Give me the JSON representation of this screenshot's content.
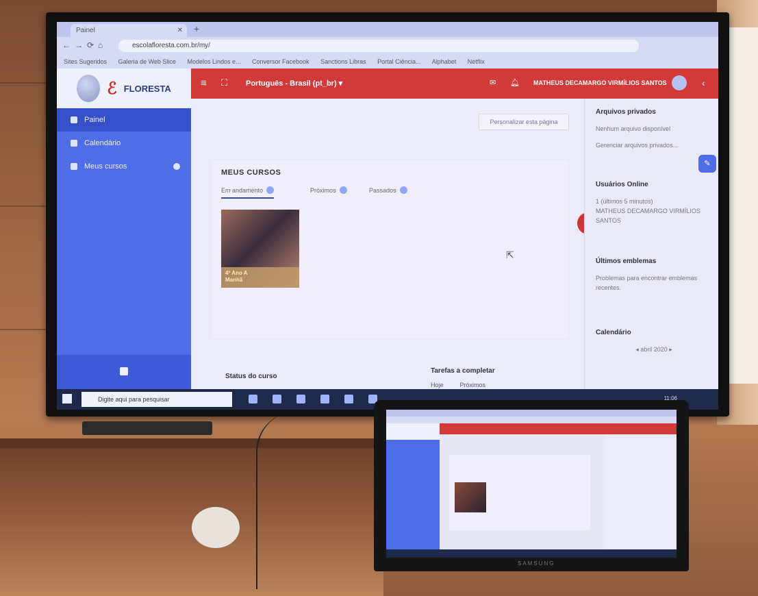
{
  "browser": {
    "tab_title": "Painel",
    "url": "escolafloresta.com.br/my/",
    "bookmarks": [
      "Sites Sugeridos",
      "Galeria de Web Slice",
      "Modelos Lindos e...",
      "Conversor Facebook",
      "Sanctions Libras",
      "Portal Ciência...",
      "Alphabet",
      "Netflix"
    ]
  },
  "moodle": {
    "logo_text": "FLORESTA",
    "sidebar": {
      "items": [
        {
          "label": "Painel",
          "active": true
        },
        {
          "label": "Calendário",
          "active": false
        },
        {
          "label": "Meus cursos",
          "active": false
        }
      ]
    },
    "topbar": {
      "language": "Português - Brasil (pt_br) ▾",
      "user_name": "MATHEUS DECAMARGO VIRMÍLIOS SANTOS"
    },
    "main": {
      "customize_button": "Personalizar esta página",
      "section_title": "MEUS CURSOS",
      "tabs": [
        "Em andamento",
        "Próximos",
        "Passados"
      ],
      "course_card_label": "4º Ano A\nManhã",
      "status_label": "Status do curso",
      "tasks_title": "Tarefas a completar",
      "tasks_tabs": [
        "Hoje",
        "Próximos"
      ]
    },
    "right_panel": {
      "private_files_title": "Arquivos privados",
      "private_files_empty": "Nenhum arquivo disponível",
      "private_files_link": "Gerenciar arquivos privados...",
      "online_users_title": "Usuários Online",
      "online_users_text": "1 (últimos 5 minutos)",
      "online_user_name": "MATHEUS DECAMARGO VIRMÍLIOS SANTOS",
      "latest_badges_title": "Últimos emblemas",
      "latest_badges_text": "Problemas para encontrar emblemas recentes.",
      "calendar_title": "Calendário",
      "calendar_month": "◂ abril 2020 ▸"
    },
    "taskbar": {
      "search_placeholder": "Digite aqui para pesquisar",
      "clock": "11:06"
    }
  },
  "laptop": {
    "brand": "SAMSUNG"
  }
}
